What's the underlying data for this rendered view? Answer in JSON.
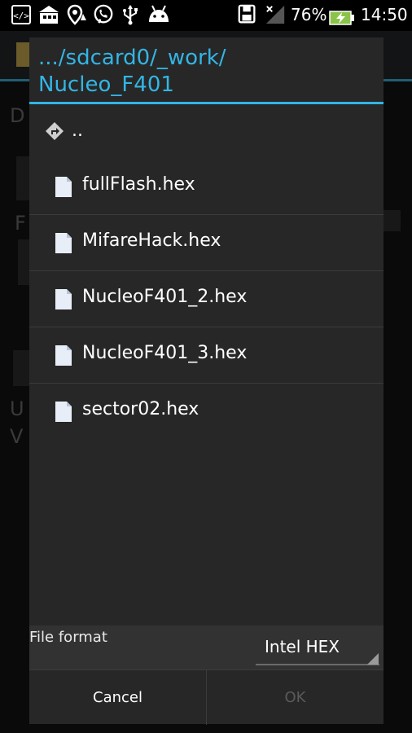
{
  "status_bar": {
    "battery_percent": "76%",
    "time": "14:50"
  },
  "dialog": {
    "title_line1": ".../sdcard0/_work/",
    "title_line2": "Nucleo_F401",
    "parent_item": "..",
    "files": [
      "fullFlash.hex",
      "MifareHack.hex",
      "NucleoF401_2.hex",
      "NucleoF401_3.hex",
      "sector02.hex"
    ],
    "file_format_label": "File format",
    "file_format_value": "Intel HEX",
    "cancel_label": "Cancel",
    "ok_label": "OK"
  },
  "colors": {
    "accent": "#33b5e5",
    "dialog_bg": "#272727"
  }
}
